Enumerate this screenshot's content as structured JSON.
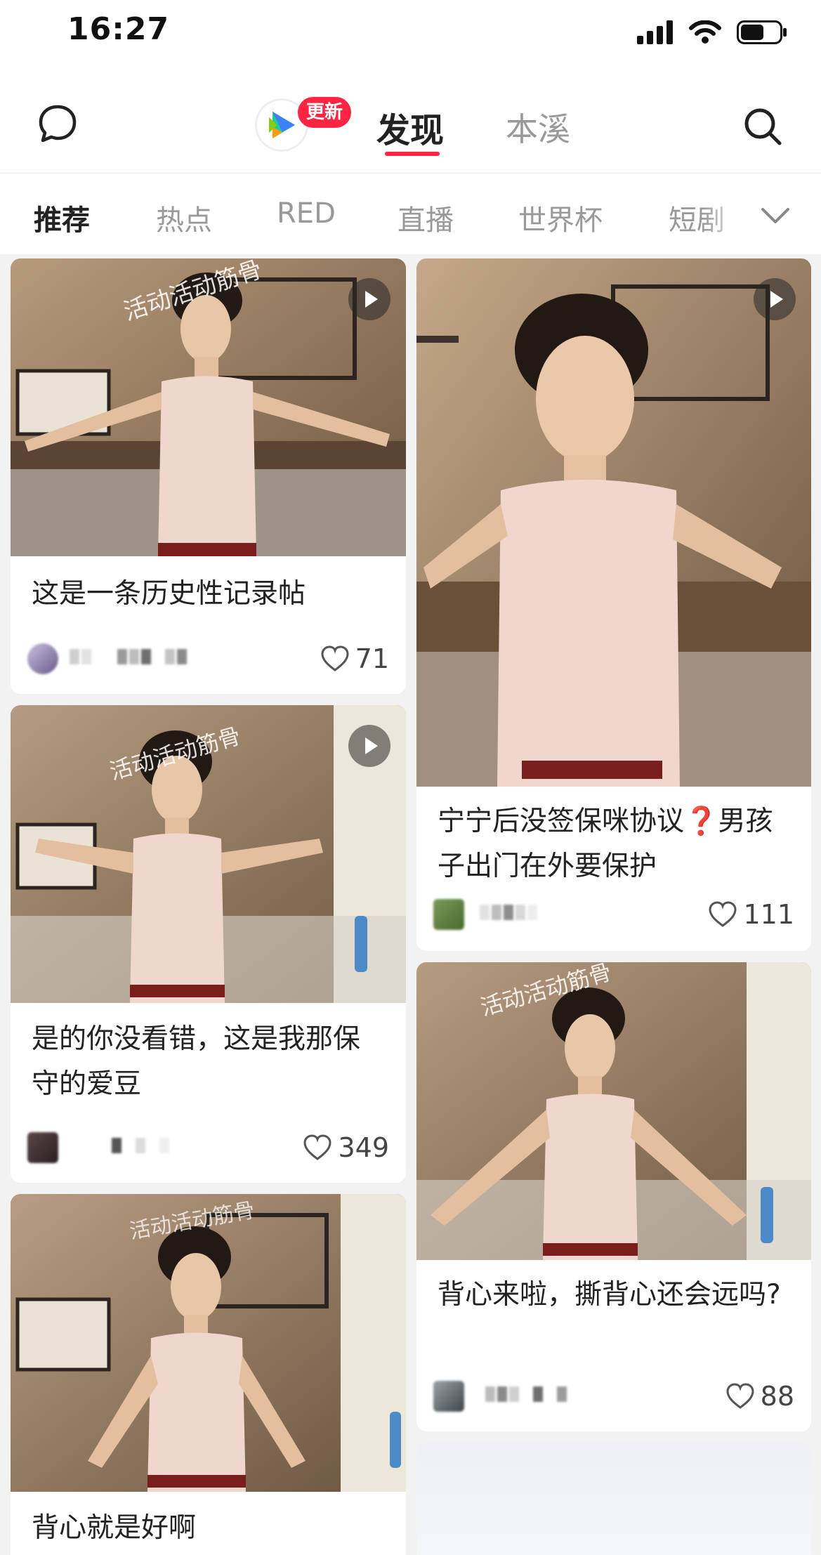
{
  "status_bar": {
    "time": "16:27"
  },
  "top_nav": {
    "update_badge": "更新",
    "tab_discover": "发现",
    "tab_local": "本溪"
  },
  "categories": [
    "推荐",
    "热点",
    "RED",
    "直播",
    "世界杯",
    "短剧"
  ],
  "posts": [
    {
      "title": "这是一条历史性记录帖",
      "likes": "71",
      "is_video": true,
      "image_caption": "活动活动筋骨"
    },
    {
      "title": "宁宁后没签保咪协议❓男孩子出门在外要保护",
      "likes": "111",
      "is_video": true
    },
    {
      "title": "是的你没看错，这是我那保守的爱豆",
      "likes": "349",
      "is_video": true,
      "image_caption": "活动活动筋骨"
    },
    {
      "title": "背心来啦，撕背心还会远吗?",
      "likes": "88",
      "is_video": false,
      "image_caption": "活动活动筋骨"
    },
    {
      "title": "背心就是好啊",
      "is_video": false,
      "image_caption": "活动活动筋骨"
    }
  ],
  "colors": {
    "accent": "#ff2442",
    "background": "#f2f2f2"
  }
}
